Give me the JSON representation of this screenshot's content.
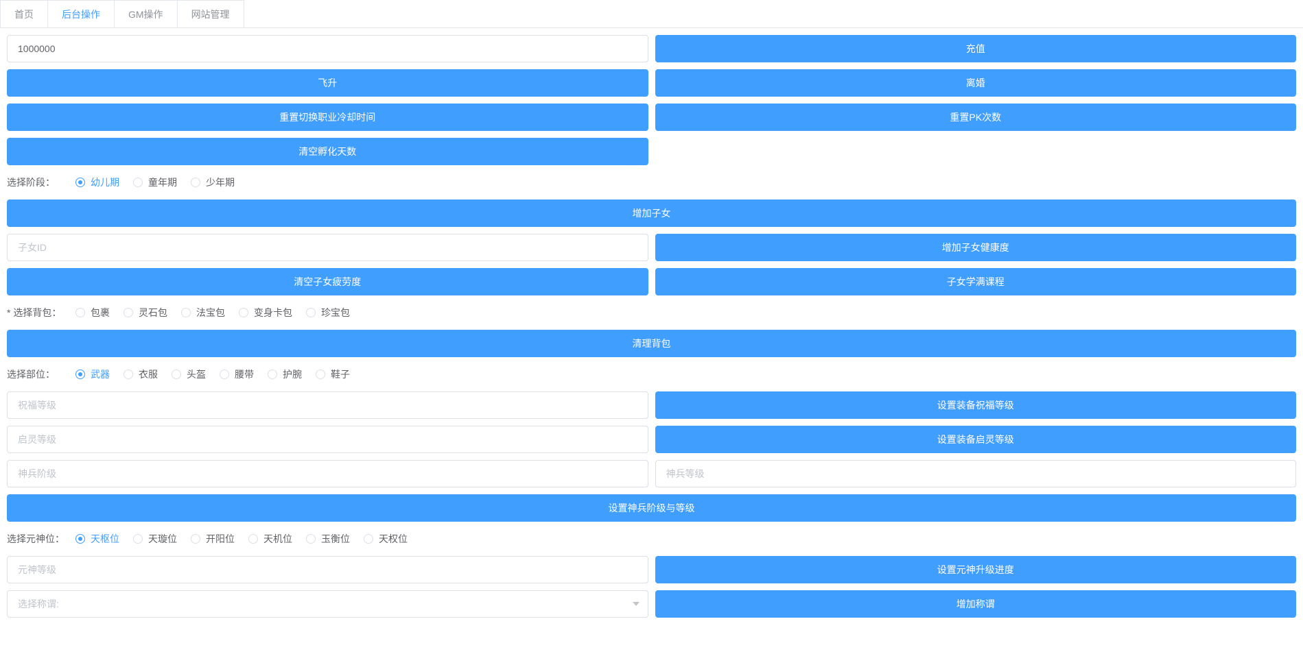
{
  "tabs": {
    "items": [
      {
        "label": "首页"
      },
      {
        "label": "后台操作"
      },
      {
        "label": "GM操作"
      },
      {
        "label": "网站管理"
      }
    ],
    "active_index": 1
  },
  "inputs": {
    "amount_value": "1000000",
    "child_id_placeholder": "子女ID",
    "bless_level_placeholder": "祝福等级",
    "qiling_level_placeholder": "启灵等级",
    "shenbing_stage_placeholder": "神兵阶级",
    "shenbing_level_placeholder": "神兵等级",
    "yuanshen_level_placeholder": "元神等级",
    "select_title_placeholder": "选择称谓:"
  },
  "buttons": {
    "recharge": "充值",
    "ascend": "飞升",
    "divorce": "离婚",
    "reset_job_cooldown": "重置切换职业冷却时间",
    "reset_pk_count": "重置PK次数",
    "clear_hatch_days": "清空孵化天数",
    "add_child": "增加子女",
    "add_child_health": "增加子女健康度",
    "clear_child_fatigue": "清空子女疲劳度",
    "child_full_course": "子女学满课程",
    "clear_bag": "清理背包",
    "set_equip_bless_level": "设置装备祝福等级",
    "set_equip_qiling_level": "设置装备启灵等级",
    "set_shenbing_stage_level": "设置神兵阶级与等级",
    "set_yuanshen_upgrade_progress": "设置元神升级进度",
    "add_title": "增加称谓"
  },
  "labels": {
    "select_stage": "选择阶段：",
    "select_bag": "选择背包：",
    "select_part": "选择部位：",
    "select_yuanshen": "选择元神位："
  },
  "radio_groups": {
    "stage": {
      "options": [
        {
          "label": "幼儿期"
        },
        {
          "label": "童年期"
        },
        {
          "label": "少年期"
        }
      ],
      "selected_index": 0
    },
    "bag": {
      "options": [
        {
          "label": "包裹"
        },
        {
          "label": "灵石包"
        },
        {
          "label": "法宝包"
        },
        {
          "label": "变身卡包"
        },
        {
          "label": "珍宝包"
        }
      ],
      "selected_index": -1
    },
    "part": {
      "options": [
        {
          "label": "武器"
        },
        {
          "label": "衣服"
        },
        {
          "label": "头盔"
        },
        {
          "label": "腰带"
        },
        {
          "label": "护腕"
        },
        {
          "label": "鞋子"
        }
      ],
      "selected_index": 0
    },
    "yuanshen": {
      "options": [
        {
          "label": "天枢位"
        },
        {
          "label": "天璇位"
        },
        {
          "label": "开阳位"
        },
        {
          "label": "天机位"
        },
        {
          "label": "玉衡位"
        },
        {
          "label": "天权位"
        }
      ],
      "selected_index": 0
    }
  }
}
